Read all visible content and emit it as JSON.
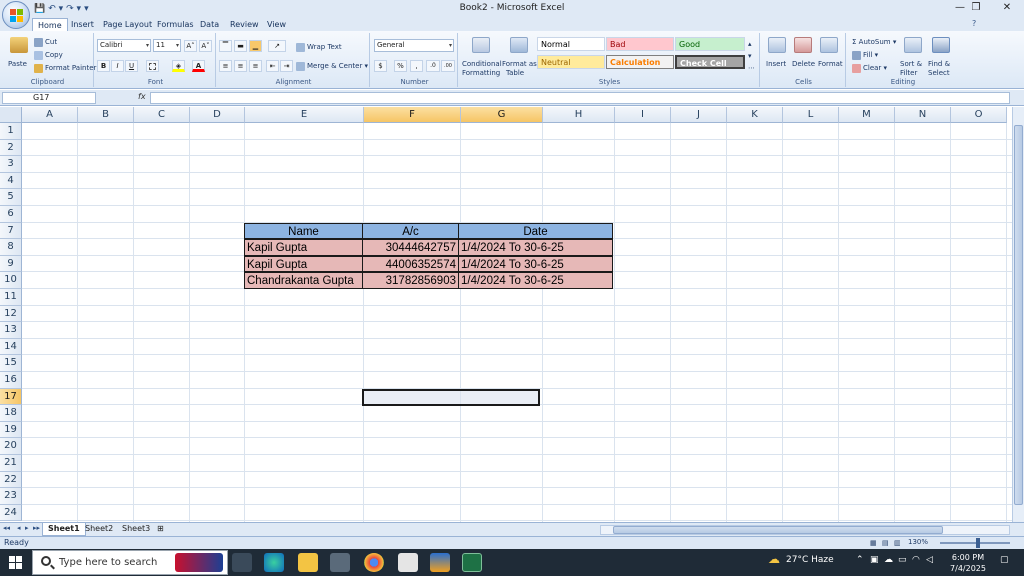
{
  "window": {
    "title": "Book2 - Microsoft Excel",
    "minimize": "—",
    "restore": "❒",
    "close": "✕"
  },
  "qat": {
    "save": "💾",
    "undo": "↶ ▾",
    "redo": "↷ ▾",
    "customize": "▾"
  },
  "ribbon_tabs": [
    {
      "label": "Home",
      "active": true
    },
    {
      "label": "Insert"
    },
    {
      "label": "Page Layout"
    },
    {
      "label": "Formulas"
    },
    {
      "label": "Data"
    },
    {
      "label": "Review"
    },
    {
      "label": "View"
    }
  ],
  "clipboard": {
    "paste": "Paste",
    "cut": "Cut",
    "copy": "Copy",
    "format_painter": "Format Painter",
    "label": "Clipboard"
  },
  "font": {
    "name": "Calibri",
    "size": "11",
    "grow": "A˄",
    "shrink": "A˅",
    "bold": "B",
    "italic": "I",
    "underline": "U",
    "label": "Font"
  },
  "alignment": {
    "wrap_text": "Wrap Text",
    "merge_center": "Merge & Center",
    "label": "Alignment"
  },
  "number": {
    "format": "General",
    "currency": "$",
    "percent": "%",
    "comma": ",",
    "inc_decimal": ".0",
    "dec_decimal": ".00",
    "label": "Number"
  },
  "styles": {
    "conditional": "Conditional",
    "conditional2": "Formatting",
    "format_as": "Format as",
    "format_as2": "Table",
    "cells": [
      {
        "label": "Normal",
        "bg": "#ffffff",
        "fg": "#000000"
      },
      {
        "label": "Bad",
        "bg": "#ffc7ce",
        "fg": "#9c0006"
      },
      {
        "label": "Good",
        "bg": "#c6efce",
        "fg": "#006100"
      },
      {
        "label": "Neutral",
        "bg": "#ffeb9c",
        "fg": "#9c6500"
      },
      {
        "label": "Calculation",
        "bg": "#f2f2f2",
        "fg": "#fa7d00"
      },
      {
        "label": "Check Cell",
        "bg": "#a5a5a5",
        "fg": "#ffffff"
      }
    ],
    "label": "Styles"
  },
  "cells_group": {
    "insert": "Insert",
    "delete": "Delete",
    "format": "Format",
    "label": "Cells"
  },
  "editing": {
    "autosum": "AutoSum",
    "fill": "Fill",
    "clear": "Clear",
    "sort": "Sort &",
    "sort2": "Filter",
    "find": "Find &",
    "find2": "Select",
    "label": "Editing"
  },
  "formula_bar": {
    "name_box": "G17",
    "fx": "fx",
    "value": ""
  },
  "columns": [
    "A",
    "B",
    "C",
    "D",
    "E",
    "F",
    "G",
    "H",
    "I",
    "J",
    "K",
    "L",
    "M",
    "N",
    "O"
  ],
  "rows": [
    "1",
    "2",
    "3",
    "4",
    "5",
    "6",
    "7",
    "8",
    "9",
    "10",
    "11",
    "12",
    "13",
    "14",
    "15",
    "16",
    "17",
    "18",
    "19",
    "20",
    "21",
    "22",
    "23",
    "24"
  ],
  "selected_cell": "G17",
  "table": {
    "headers": [
      "Name",
      "A/c",
      "Date"
    ],
    "rows": [
      [
        "Kapil Gupta",
        "30444642757",
        "1/4/2024 To 30-6-25"
      ],
      [
        "Kapil Gupta",
        "44006352574",
        "1/4/2024 To 30-6-25"
      ],
      [
        "Chandrakanta Gupta",
        "31782856903",
        "1/4/2024 To 30-6-25"
      ]
    ],
    "header_bg": "#8db4e2",
    "row_bg": "#e6b8b7"
  },
  "sheet_tabs": [
    {
      "label": "Sheet1",
      "active": true
    },
    {
      "label": "Sheet2"
    },
    {
      "label": "Sheet3"
    }
  ],
  "status": {
    "ready": "Ready",
    "zoom": "130%"
  },
  "taskbar": {
    "search_placeholder": "Type here to search",
    "weather": "27°C  Haze",
    "time": "6:00 PM",
    "date": "7/4/2025"
  }
}
